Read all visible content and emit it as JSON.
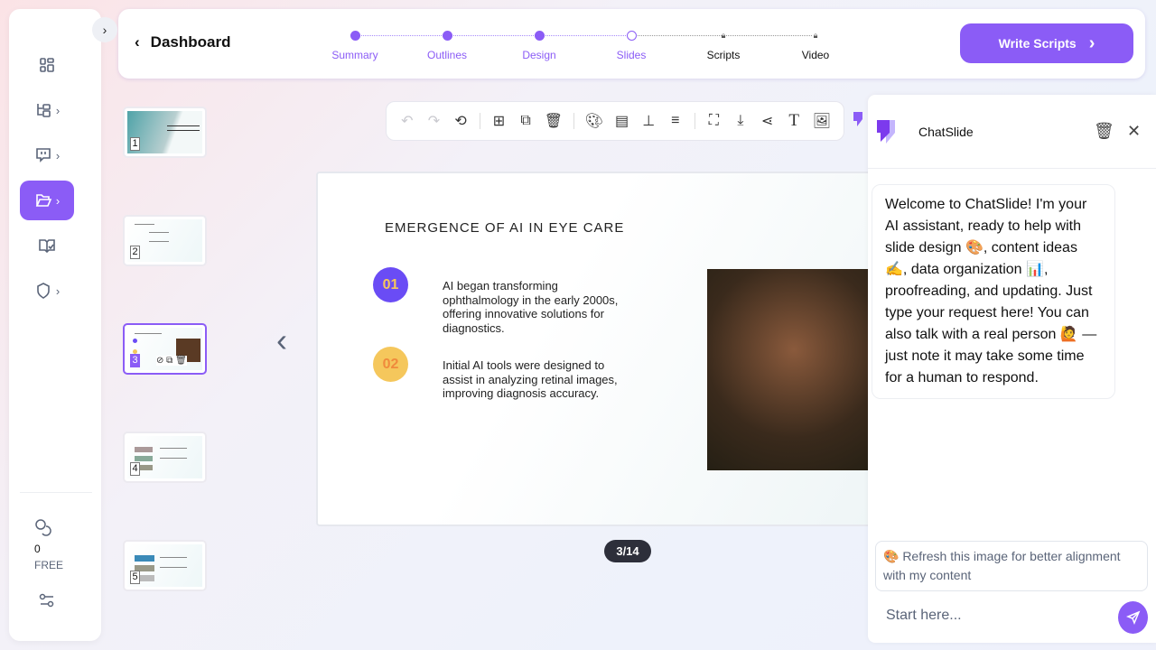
{
  "sidebar": {
    "credits_value": "0",
    "plan": "FREE"
  },
  "header": {
    "back_label": "Dashboard",
    "steps": [
      {
        "label": "Summary",
        "state": "done"
      },
      {
        "label": "Outlines",
        "state": "done"
      },
      {
        "label": "Design",
        "state": "done"
      },
      {
        "label": "Slides",
        "state": "current"
      },
      {
        "label": "Scripts",
        "state": "locked"
      },
      {
        "label": "Video",
        "state": "locked"
      }
    ],
    "write_scripts": "Write Scripts"
  },
  "thumbnails": [
    "1",
    "2",
    "3",
    "4",
    "5"
  ],
  "slide": {
    "title": "EMERGENCE OF AI IN EYE CARE",
    "points": [
      {
        "num": "01",
        "text": "AI began transforming ophthalmology in the early 2000s, offering innovative solutions for diagnostics.",
        "color": "#6a4cf5"
      },
      {
        "num": "02",
        "text": "Initial AI tools were designed to assist in analyzing retinal images, improving diagnosis accuracy.",
        "color": "#f5c75c"
      }
    ]
  },
  "pager": "3/14",
  "chat": {
    "title": "ChatSlide",
    "welcome": "Welcome to ChatSlide! I'm your AI assistant, ready to help with slide design 🎨, content ideas ✍️, data organization 📊, proofreading, and updating. Just type your request here! You can also talk with a real person 🙋 — just note it may take some time for a human to respond.",
    "suggestion": "🎨 Refresh this image for better alignment with my content",
    "placeholder": "Start here..."
  },
  "colors": {
    "accent": "#8b5cf6"
  }
}
